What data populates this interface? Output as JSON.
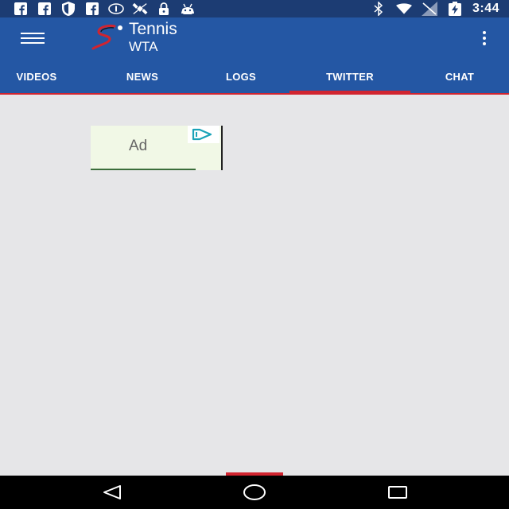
{
  "status_bar": {
    "time": "3:44",
    "left_icons": [
      "facebook-icon",
      "facebook-icon",
      "shield-icon",
      "facebook-icon",
      "data-saver-icon",
      "satellite-icon",
      "lock-icon",
      "android-icon"
    ],
    "right_icons": [
      "bluetooth-icon",
      "wifi-icon",
      "signal-icon",
      "battery-charging-icon"
    ]
  },
  "app_bar": {
    "title": "Tennis",
    "subtitle": "WTA",
    "menu_icon": "hamburger-menu-icon",
    "overflow_icon": "more-vert-icon",
    "logo_icon": "supersport-logo-icon"
  },
  "tabs": [
    {
      "label": "VIDEOS",
      "selected": false
    },
    {
      "label": "NEWS",
      "selected": false
    },
    {
      "label": "LOGS",
      "selected": false
    },
    {
      "label": "TWITTER",
      "selected": true
    },
    {
      "label": "CHAT",
      "selected": false
    }
  ],
  "ad": {
    "label": "Ad",
    "badge_icon": "adchoices-icon"
  },
  "nav_bar": {
    "back_icon": "back-triangle-icon",
    "home_icon": "home-circle-icon",
    "recents_icon": "recents-square-icon"
  },
  "colors": {
    "primary": "#2457a4",
    "status_bar": "#1c3c73",
    "accent": "#d1242f",
    "background": "#e6e6e8"
  }
}
